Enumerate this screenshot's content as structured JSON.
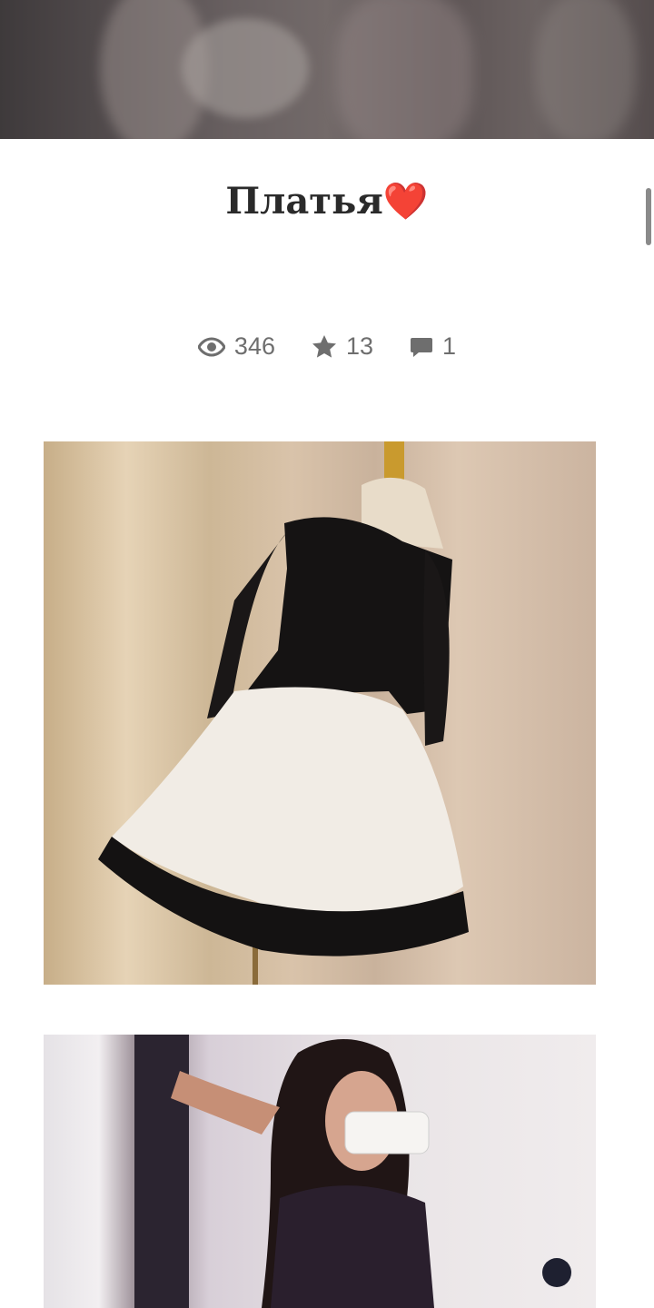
{
  "post": {
    "title": "Платья",
    "title_emoji": "❤️"
  },
  "stats": {
    "views": "346",
    "stars": "13",
    "comments": "1"
  },
  "icons": {
    "views": "eye-icon",
    "stars": "star-icon",
    "comments": "comment-icon"
  },
  "colors": {
    "heart": "#e0242a",
    "stats_text": "#6e6e6e"
  }
}
